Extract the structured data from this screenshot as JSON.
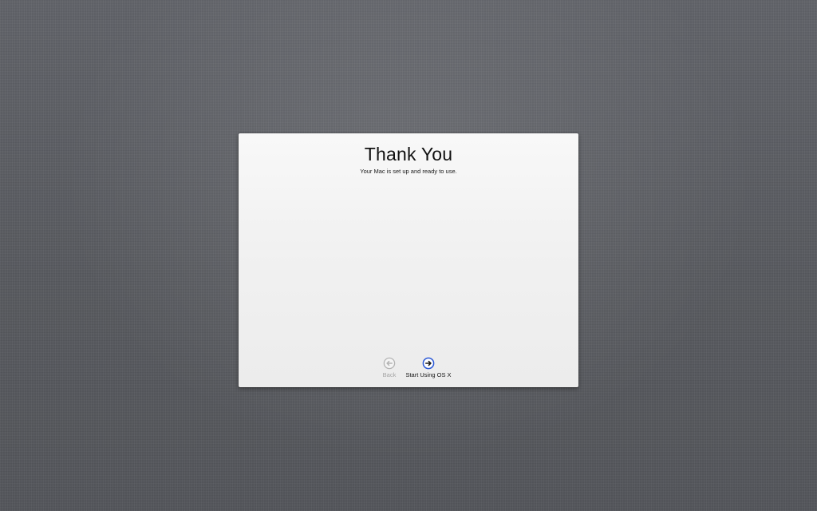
{
  "setup_assistant": {
    "title": "Thank You",
    "subtitle": "Your Mac is set up and ready to use.",
    "back_button": {
      "label": "Back",
      "icon": "arrow-left-circle-icon",
      "enabled": false,
      "color": "#b4b4b4"
    },
    "start_button": {
      "label": "Start Using OS X",
      "icon": "arrow-right-circle-icon",
      "enabled": true,
      "color": "#2a58d6"
    }
  },
  "colors": {
    "background": "#5b5d62",
    "panel": "#f2f2f2"
  }
}
